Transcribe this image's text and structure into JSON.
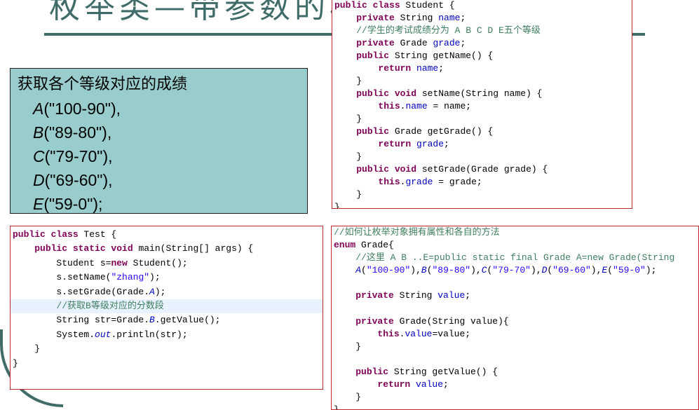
{
  "slide": {
    "title": "枚举类—带参数的构造函数"
  },
  "grades_box": {
    "heading": "获取各个等级对应的成绩",
    "items": [
      {
        "letter": "A",
        "rest": "(\"100-90\"),"
      },
      {
        "letter": "B",
        "rest": "(\"89-80\"),"
      },
      {
        "letter": "C",
        "rest": "(\"79-70\"),"
      },
      {
        "letter": "D",
        "rest": "(\"69-60\"),"
      },
      {
        "letter": "E",
        "rest": "(\"59-0\");"
      }
    ]
  },
  "code_panels": [
    {
      "name": "student-class-code",
      "lines": [
        [
          [
            "kw",
            "public class "
          ],
          [
            "tx",
            "Student {"
          ]
        ],
        [
          [
            "tx",
            "    "
          ],
          [
            "kw",
            "private "
          ],
          [
            "tx",
            "String "
          ],
          [
            "fd",
            "name"
          ],
          [
            "tx",
            ";"
          ]
        ],
        [
          [
            "tx",
            "    "
          ],
          [
            "cm",
            "//学生的考试成绩分为 A B C D E五个等级"
          ]
        ],
        [
          [
            "tx",
            "    "
          ],
          [
            "kw",
            "private "
          ],
          [
            "tx",
            "Grade "
          ],
          [
            "fd",
            "grade"
          ],
          [
            "tx",
            ";"
          ]
        ],
        [
          [
            "tx",
            "    "
          ],
          [
            "kw",
            "public "
          ],
          [
            "tx",
            "String getName() {"
          ]
        ],
        [
          [
            "tx",
            "        "
          ],
          [
            "kw",
            "return "
          ],
          [
            "fd",
            "name"
          ],
          [
            "tx",
            ";"
          ]
        ],
        [
          [
            "tx",
            "    }"
          ]
        ],
        [
          [
            "tx",
            "    "
          ],
          [
            "kw",
            "public void "
          ],
          [
            "tx",
            "setName(String name) {"
          ]
        ],
        [
          [
            "tx",
            "        "
          ],
          [
            "kw",
            "this"
          ],
          [
            "tx",
            "."
          ],
          [
            "fd",
            "name"
          ],
          [
            "tx",
            " = name;"
          ]
        ],
        [
          [
            "tx",
            "    }"
          ]
        ],
        [
          [
            "tx",
            "    "
          ],
          [
            "kw",
            "public "
          ],
          [
            "tx",
            "Grade getGrade() {"
          ]
        ],
        [
          [
            "tx",
            "        "
          ],
          [
            "kw",
            "return "
          ],
          [
            "fd",
            "grade"
          ],
          [
            "tx",
            ";"
          ]
        ],
        [
          [
            "tx",
            "    }"
          ]
        ],
        [
          [
            "tx",
            "    "
          ],
          [
            "kw",
            "public void "
          ],
          [
            "tx",
            "setGrade(Grade grade) {"
          ]
        ],
        [
          [
            "tx",
            "        "
          ],
          [
            "kw",
            "this"
          ],
          [
            "tx",
            "."
          ],
          [
            "fd",
            "grade"
          ],
          [
            "tx",
            " = grade;"
          ]
        ],
        [
          [
            "tx",
            "    }"
          ]
        ],
        [
          [
            "tx",
            "}"
          ]
        ]
      ]
    },
    {
      "name": "test-class-code",
      "highlight_line": 5,
      "lines": [
        [
          [
            "kw",
            "public class "
          ],
          [
            "tx",
            "Test {"
          ]
        ],
        [
          [
            "tx",
            "    "
          ],
          [
            "kw",
            "public static void "
          ],
          [
            "tx",
            "main(String[] args) {"
          ]
        ],
        [
          [
            "tx",
            "        Student s="
          ],
          [
            "kw",
            "new "
          ],
          [
            "tx",
            "Student();"
          ]
        ],
        [
          [
            "tx",
            "        s.setName("
          ],
          [
            "st",
            "\"zhang\""
          ],
          [
            "tx",
            ");"
          ]
        ],
        [
          [
            "tx",
            "        s.setGrade(Grade."
          ],
          [
            "sf",
            "A"
          ],
          [
            "tx",
            ");"
          ]
        ],
        [
          [
            "tx",
            "        "
          ],
          [
            "cm",
            "//获取B等级对应的分数段"
          ]
        ],
        [
          [
            "tx",
            "        String str=Grade."
          ],
          [
            "sf",
            "B"
          ],
          [
            "tx",
            ".getValue();"
          ]
        ],
        [
          [
            "tx",
            "        System."
          ],
          [
            "sf",
            "out"
          ],
          [
            "tx",
            ".println(str);"
          ]
        ],
        [
          [
            "tx",
            "    }"
          ]
        ],
        [
          [
            "tx",
            "}"
          ]
        ]
      ]
    },
    {
      "name": "grade-enum-code",
      "lines": [
        [
          [
            "cm",
            "//如何让枚举对象拥有属性和各自的方法"
          ]
        ],
        [
          [
            "kw",
            "enum "
          ],
          [
            "tx",
            "Grade{"
          ]
        ],
        [
          [
            "tx",
            "    "
          ],
          [
            "cm",
            "//这里 A B ..E=public static final Grade A=new Grade(String"
          ]
        ],
        [
          [
            "tx",
            "    "
          ],
          [
            "sf",
            "A"
          ],
          [
            "tx",
            "("
          ],
          [
            "st",
            "\"100-90\""
          ],
          [
            "tx",
            "),"
          ],
          [
            "sf",
            "B"
          ],
          [
            "tx",
            "("
          ],
          [
            "st",
            "\"89-80\""
          ],
          [
            "tx",
            "),"
          ],
          [
            "sf",
            "C"
          ],
          [
            "tx",
            "("
          ],
          [
            "st",
            "\"79-70\""
          ],
          [
            "tx",
            "),"
          ],
          [
            "sf",
            "D"
          ],
          [
            "tx",
            "("
          ],
          [
            "st",
            "\"69-60\""
          ],
          [
            "tx",
            "),"
          ],
          [
            "sf",
            "E"
          ],
          [
            "tx",
            "("
          ],
          [
            "st",
            "\"59-0\""
          ],
          [
            "tx",
            ");"
          ]
        ],
        [
          [
            "tx",
            " "
          ]
        ],
        [
          [
            "tx",
            "    "
          ],
          [
            "kw",
            "private "
          ],
          [
            "tx",
            "String "
          ],
          [
            "fd",
            "value"
          ],
          [
            "tx",
            ";"
          ]
        ],
        [
          [
            "tx",
            " "
          ]
        ],
        [
          [
            "tx",
            "    "
          ],
          [
            "kw",
            "private "
          ],
          [
            "tx",
            "Grade(String value){"
          ]
        ],
        [
          [
            "tx",
            "        "
          ],
          [
            "kw",
            "this"
          ],
          [
            "tx",
            "."
          ],
          [
            "fd",
            "value"
          ],
          [
            "tx",
            "=value;"
          ]
        ],
        [
          [
            "tx",
            "    }"
          ]
        ],
        [
          [
            "tx",
            " "
          ]
        ],
        [
          [
            "tx",
            "    "
          ],
          [
            "kw",
            "public "
          ],
          [
            "tx",
            "String getValue() {"
          ]
        ],
        [
          [
            "tx",
            "        "
          ],
          [
            "kw",
            "return "
          ],
          [
            "fd",
            "value"
          ],
          [
            "tx",
            ";"
          ]
        ],
        [
          [
            "tx",
            "    }"
          ]
        ],
        [
          [
            "tx",
            "}"
          ]
        ]
      ]
    }
  ],
  "colors": {
    "accent": "#3f6b68",
    "box": "#99cccc",
    "panel_border": "#c0282d"
  }
}
